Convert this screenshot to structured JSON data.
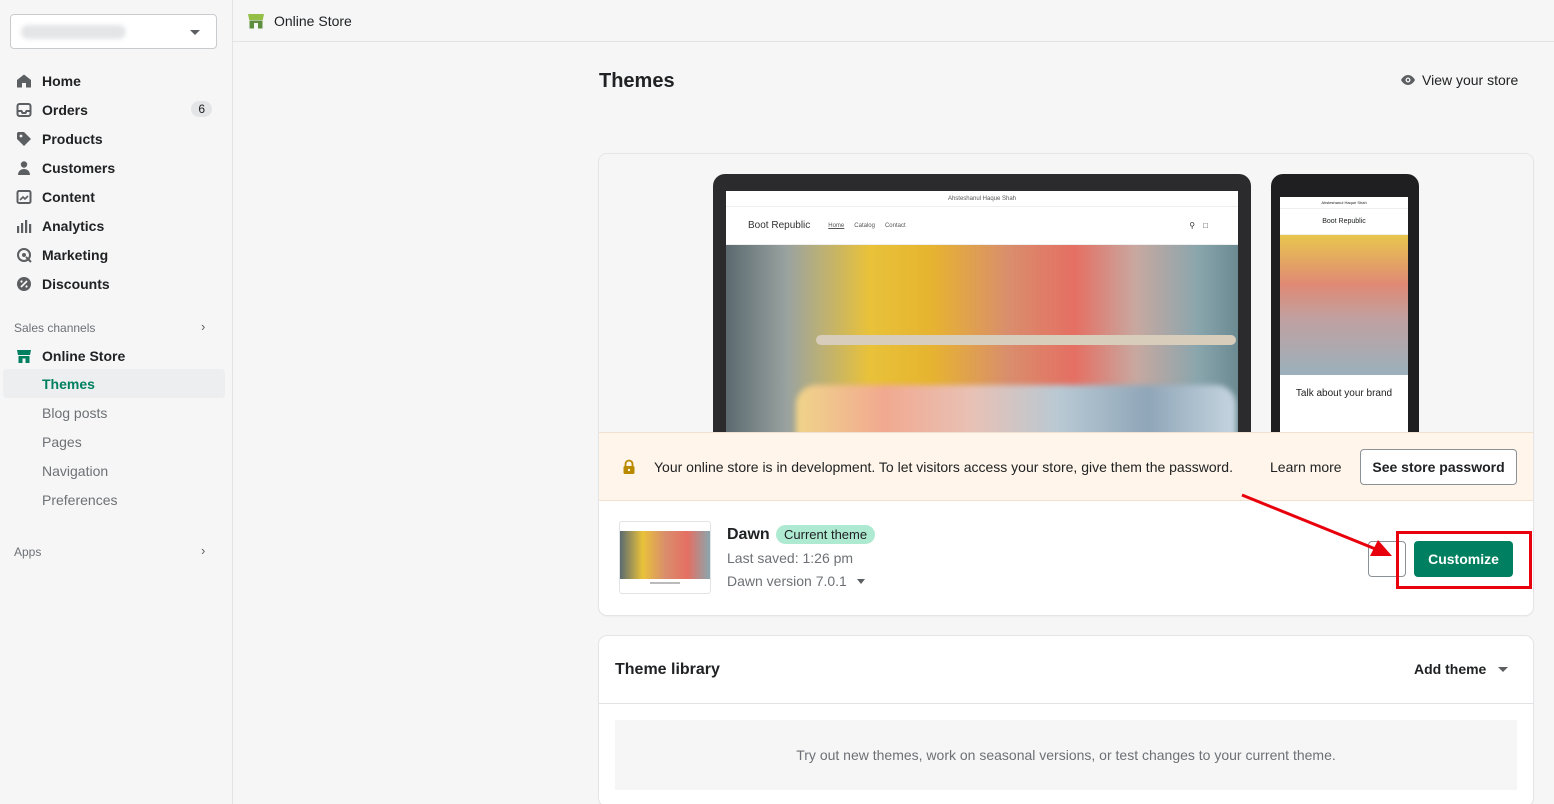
{
  "sidebar": {
    "nav": [
      {
        "label": "Home",
        "icon": "home-icon"
      },
      {
        "label": "Orders",
        "icon": "orders-icon",
        "badge": "6"
      },
      {
        "label": "Products",
        "icon": "tag-icon"
      },
      {
        "label": "Customers",
        "icon": "person-icon"
      },
      {
        "label": "Content",
        "icon": "content-icon"
      },
      {
        "label": "Analytics",
        "icon": "analytics-icon"
      },
      {
        "label": "Marketing",
        "icon": "marketing-icon"
      },
      {
        "label": "Discounts",
        "icon": "discount-icon"
      }
    ],
    "sales_channels_label": "Sales channels",
    "online_store_label": "Online Store",
    "online_store_sub": [
      "Themes",
      "Blog posts",
      "Pages",
      "Navigation",
      "Preferences"
    ],
    "apps_label": "Apps"
  },
  "topbar": {
    "title": "Online Store"
  },
  "page": {
    "title": "Themes",
    "view_store": "View your store"
  },
  "preview": {
    "announcement": "Ahsteshanul Haque Shah",
    "brand": "Boot Republic",
    "links": [
      "Home",
      "Catalog",
      "Contact"
    ],
    "phone_text": "Talk about your brand"
  },
  "banner": {
    "message": "Your online store is in development. To let visitors access your store, give them the password.",
    "learn_more": "Learn more",
    "password_button": "See store password"
  },
  "theme": {
    "name": "Dawn",
    "badge": "Current theme",
    "last_saved": "Last saved: 1:26 pm",
    "version": "Dawn version 7.0.1",
    "customize_label": "Customize"
  },
  "library": {
    "title": "Theme library",
    "add_theme": "Add theme",
    "empty_text": "Try out new themes, work on seasonal versions, or test changes to your current theme."
  },
  "colors": {
    "accent": "#008060",
    "highlight": "#e8000c",
    "badge": "#aee9d1"
  }
}
